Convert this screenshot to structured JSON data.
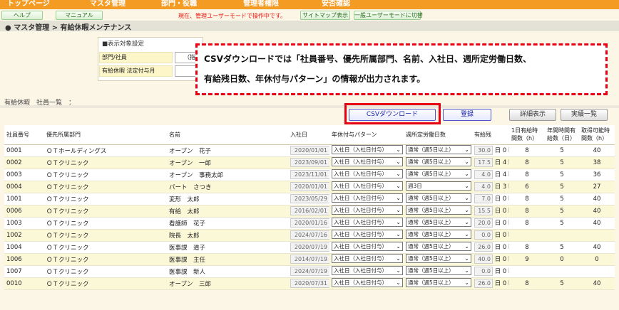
{
  "nav": {
    "items": [
      "トップページ",
      "マスタ管理",
      "部門・役職",
      "管理者権限",
      "安否確認"
    ]
  },
  "subbar": {
    "help": "ヘルプ",
    "manual": "マニュアル",
    "mode_notice": "現在、管理ユーザーモードで操作中です。",
    "sitemap": "サイトマップ表示",
    "switch_user": "一般ユーザーモードに切替"
  },
  "breadcrumb": "● マスタ管理 > 有給休暇メンテナンス",
  "filter": {
    "title": "■表示対象設定",
    "dept_label": "部門/社員",
    "dept_value": "（指",
    "leave_label": "有給休暇 法定付与月",
    "leave_value": ""
  },
  "callout": {
    "line1": "CSVダウンロードでは「社員番号、優先所属部門、名前、入社日、週所定労働日数、",
    "line2": "有給残日数、年休付与パターン」の情報が出力されます。"
  },
  "list": {
    "title": "有給休暇　社員一覧　："
  },
  "buttons": {
    "csv": "CSVダウンロード",
    "register": "登録",
    "detail": "詳細表示",
    "actual": "実績一覧"
  },
  "table": {
    "headers": [
      "社員番号",
      "優先所属部門",
      "名前",
      "入社日",
      "年休付与パターン",
      "週所定労働日数",
      "有給残",
      "1日有給時間数（h）",
      "年間時間有給数（日）",
      "取得可能時間数（h）"
    ],
    "unit_day": "日",
    "unit_hour": "h",
    "rows": [
      {
        "id": "0001",
        "dept": "ＯＴホールディングス",
        "name": "オープン　花子",
        "date": "2020/01/01",
        "pattern": "入社日（入社日付与）",
        "days": "通常（週5日以上）",
        "bal": "30.0",
        "hrs": "0",
        "h1": "8",
        "h2": "5",
        "h3": "40"
      },
      {
        "id": "0002",
        "dept": "ＯＴクリニック",
        "name": "オープン　一郎",
        "date": "2023/09/01",
        "pattern": "入社日（入社日付与）",
        "days": "通常（週5日以上）",
        "bal": "17.5",
        "hrs": "4",
        "h1": "8",
        "h2": "5",
        "h3": "38"
      },
      {
        "id": "0003",
        "dept": "ＯＴクリニック",
        "name": "オープン　事務太郎",
        "date": "2023/11/01",
        "pattern": "入社日（入社日付与）",
        "days": "通常（週5日以上）",
        "bal": "4.0",
        "hrs": "4",
        "h1": "8",
        "h2": "5",
        "h3": "36"
      },
      {
        "id": "0004",
        "dept": "ＯＴクリニック",
        "name": "パート　さつき",
        "date": "2020/01/01",
        "pattern": "入社日（入社日付与）",
        "days": "週3日",
        "bal": "4.0",
        "hrs": "3",
        "h1": "6",
        "h2": "5",
        "h3": "27"
      },
      {
        "id": "1001",
        "dept": "ＯＴクリニック",
        "name": "変形　太郎",
        "date": "2023/05/29",
        "pattern": "入社日（入社日付与）",
        "days": "通常（週5日以上）",
        "bal": "7.0",
        "hrs": "0",
        "h1": "8",
        "h2": "5",
        "h3": "40"
      },
      {
        "id": "0006",
        "dept": "ＯＴクリニック",
        "name": "有給　太郎",
        "date": "2016/02/01",
        "pattern": "入社日（入社日付与）",
        "days": "通常（週5日以上）",
        "bal": "15.5",
        "hrs": "0",
        "h1": "8",
        "h2": "5",
        "h3": "40"
      },
      {
        "id": "1003",
        "dept": "ＯＴクリニック",
        "name": "看護師　花子",
        "date": "2020/01/16",
        "pattern": "入社日（入社日付与）",
        "days": "通常（週5日以上）",
        "bal": "20.0",
        "hrs": "0",
        "h1": "8",
        "h2": "5",
        "h3": "40"
      },
      {
        "id": "1002",
        "dept": "ＯＴクリニック",
        "name": "院長　太郎",
        "date": "2024/07/16",
        "pattern": "入社日（入社日付与）",
        "days": "通常（週5日以上）",
        "bal": "0.0",
        "hrs": "0",
        "h1": "",
        "h2": "",
        "h3": ""
      },
      {
        "id": "1004",
        "dept": "ＯＴクリニック",
        "name": "医事課　道子",
        "date": "2020/07/19",
        "pattern": "入社日（入社日付与）",
        "days": "通常（週5日以上）",
        "bal": "26.0",
        "hrs": "0",
        "h1": "8",
        "h2": "5",
        "h3": "40"
      },
      {
        "id": "1006",
        "dept": "ＯＴクリニック",
        "name": "医事課　主任",
        "date": "2014/07/19",
        "pattern": "入社日（入社日付与）",
        "days": "通常（週5日以上）",
        "bal": "40.0",
        "hrs": "0",
        "h1": "9",
        "h2": "0",
        "h3": "0"
      },
      {
        "id": "1007",
        "dept": "ＯＴクリニック",
        "name": "医事課　新人",
        "date": "2024/07/19",
        "pattern": "入社日（入社日付与）",
        "days": "通常（週5日以上）",
        "bal": "0.0",
        "hrs": "0",
        "h1": "",
        "h2": "",
        "h3": ""
      },
      {
        "id": "0010",
        "dept": "ＯＴクリニック",
        "name": "オープン　三郎",
        "date": "2020/07/31",
        "pattern": "入社日（入社日付与）",
        "days": "通常（週5日以上）",
        "bal": "26.0",
        "hrs": "0",
        "h1": "8",
        "h2": "5",
        "h3": "40"
      }
    ]
  }
}
